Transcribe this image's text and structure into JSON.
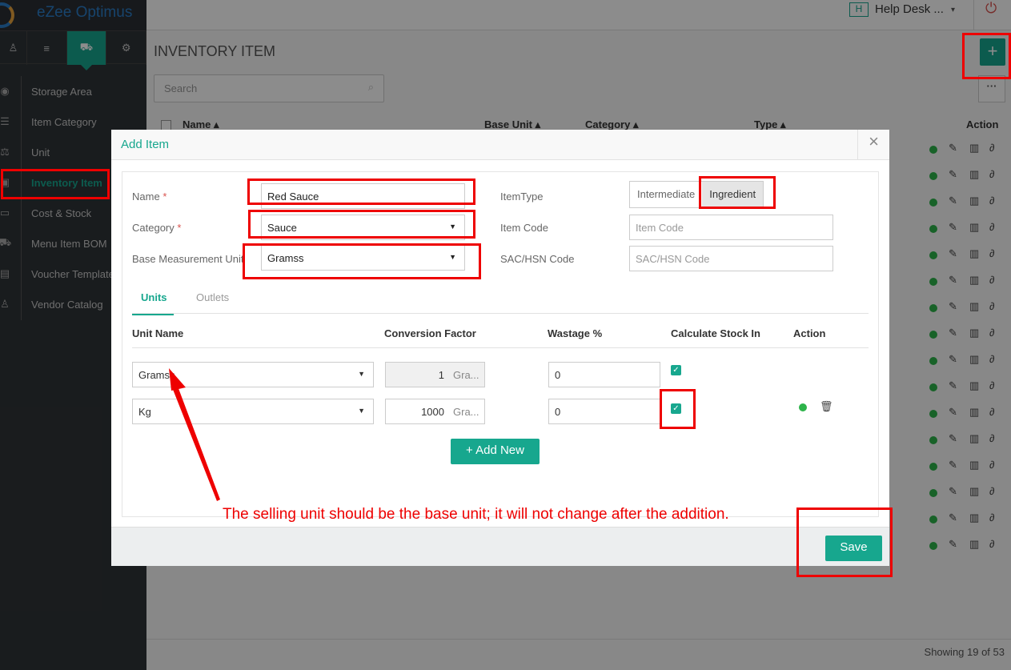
{
  "app": {
    "brand": "eZee Optimus"
  },
  "header": {
    "badge": "H",
    "property": "Help Desk ...",
    "caret": "▾",
    "power_icon": "power-icon"
  },
  "sidebar": {
    "icon_tabs": [
      {
        "icon": "user-icon",
        "glyph": "♙"
      },
      {
        "icon": "menu-icon",
        "glyph": "≡"
      },
      {
        "icon": "cart-icon",
        "glyph": "⛟"
      },
      {
        "icon": "gear-icon",
        "glyph": "⚙"
      }
    ],
    "items": [
      {
        "label": "Storage Area",
        "icon": "location-icon",
        "glyph": "◉"
      },
      {
        "label": "Item Category",
        "icon": "list-icon",
        "glyph": "☰"
      },
      {
        "label": "Unit",
        "icon": "scale-icon",
        "glyph": "⚖"
      },
      {
        "label": "Inventory Item",
        "icon": "box-icon",
        "glyph": "▣"
      },
      {
        "label": "Cost & Stock",
        "icon": "money-icon",
        "glyph": "▭"
      },
      {
        "label": "Menu Item BOM",
        "icon": "cart-icon",
        "glyph": "⛟"
      },
      {
        "label": "Voucher Template",
        "icon": "doc-icon",
        "glyph": "▤"
      },
      {
        "label": "Vendor Catalog",
        "icon": "user-icon",
        "glyph": "♙"
      }
    ]
  },
  "page": {
    "title": "INVENTORY ITEM",
    "search_placeholder": "Search",
    "add": "+",
    "more": "···",
    "columns": {
      "name": "Name ▴",
      "base_unit": "Base Unit ▴",
      "category": "Category ▴",
      "type": "Type ▴",
      "action": "Action"
    },
    "footer": "Showing 19 of 53"
  },
  "modal": {
    "title": "Add Item",
    "close": "×",
    "fields": {
      "name_label": "Name",
      "required": "*",
      "name_value": "Red Sauce",
      "category_label": "Category",
      "category_value": "Sauce",
      "base_unit_label": "Base Measurement Unit",
      "base_unit_value": "Gramss",
      "item_type_label": "ItemType",
      "item_type_options": [
        "Intermediate",
        "Ingredient"
      ],
      "item_code_label": "Item Code",
      "item_code_placeholder": "Item Code",
      "sac_label": "SAC/HSN Code",
      "sac_placeholder": "SAC/HSN Code"
    },
    "tabs": [
      "Units",
      "Outlets"
    ],
    "unit_columns": [
      "Unit Name",
      "Conversion Factor",
      "Wastage %",
      "Calculate Stock In",
      "Action"
    ],
    "units": [
      {
        "name": "Gramss",
        "factor": "1",
        "factor_unit": "Gra...",
        "wastage": "0",
        "stock": true
      },
      {
        "name": "Kg",
        "factor": "1000",
        "factor_unit": "Gra...",
        "wastage": "0",
        "stock": true
      }
    ],
    "add_new": "+ Add New",
    "save": "Save"
  },
  "annotation": {
    "note": "The selling unit should be the base unit; it will not change after the addition.",
    "color": "#ee0000"
  },
  "colors": {
    "accent": "#17a78e",
    "sidebar": "#2f3337",
    "active_dot": "#2db34a"
  }
}
